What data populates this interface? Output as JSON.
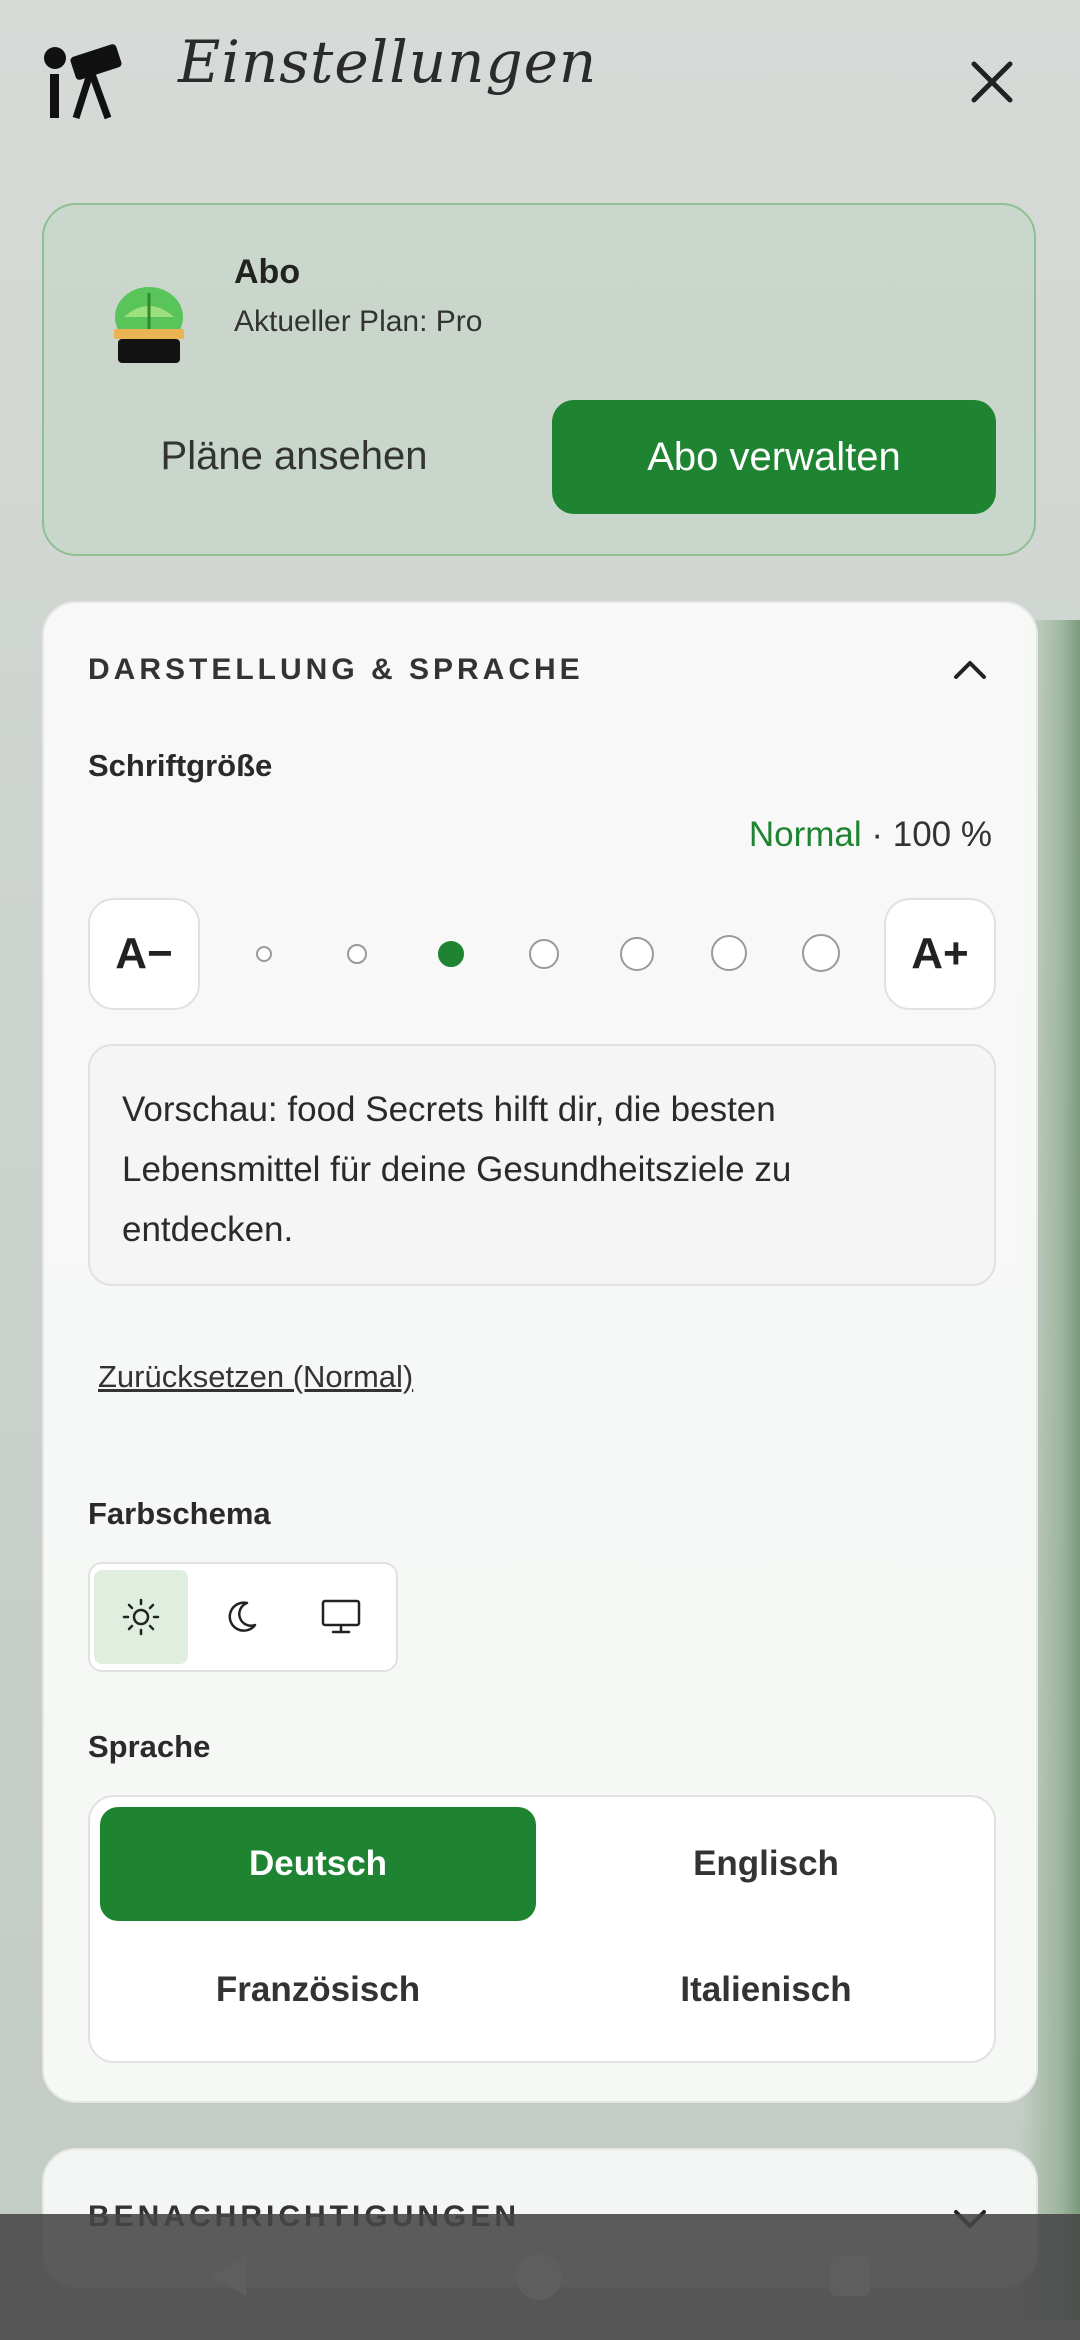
{
  "header": {
    "title": "Einstellungen",
    "logo_icon": "telescope-logo-icon",
    "close_icon": "close-icon"
  },
  "abo": {
    "title": "Abo",
    "subtitle": "Aktueller Plan: Pro",
    "icon": "plant-pot-icon",
    "plans_button": "Pläne ansehen",
    "manage_button": "Abo verwalten"
  },
  "appearance": {
    "section_title": "DARSTELLUNG & SPRACHE",
    "font_size": {
      "label": "Schriftgröße",
      "status_name": "Normal",
      "status_value": "· 100 %",
      "decrease_label": "A−",
      "increase_label": "A+",
      "steps": 7,
      "selected_step": 3
    },
    "preview_text": "Vorschau: food Secrets hilft dir, die besten Lebensmittel für deine Gesundheitsziele zu entdecken.",
    "reset_link": "Zurücksetzen (Normal)",
    "color_scheme": {
      "label": "Farbschema",
      "options": [
        "sun-icon",
        "moon-icon",
        "monitor-icon"
      ],
      "selected": "sun-icon"
    },
    "language": {
      "label": "Sprache",
      "options": [
        "Deutsch",
        "Englisch",
        "Französisch",
        "Italienisch"
      ],
      "selected": "Deutsch"
    }
  },
  "notifications": {
    "section_title": "BENACHRICHTIGUNGEN"
  },
  "colors": {
    "accent": "#1e8431",
    "accent_light": "#dfeedf"
  }
}
